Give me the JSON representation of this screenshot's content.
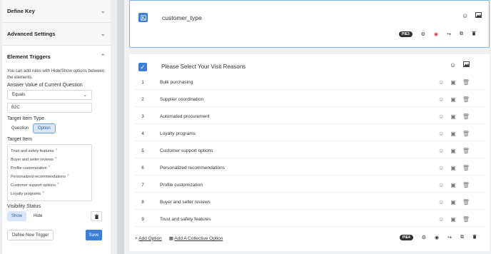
{
  "left_panel": {
    "define_key": "Define Key",
    "advanced_settings": "Advanced Settings",
    "element_triggers": "Element Triggers",
    "description": "You can add rules with Hide/Show options between the elements.",
    "answer_value_label": "Answer Value of Current Question",
    "operator_value": "Equals",
    "answer_input_value": "B2C",
    "target_item_type_label": "Target Item Type",
    "type_question": "Question",
    "type_option": "Option",
    "target_item_label": "Target Item",
    "target_items": [
      "Trust and safety features",
      "Buyer and seller reviews",
      "Profile customization",
      "Personalized recommendations",
      "Customer support options",
      "Loyalty programs"
    ],
    "visibility_status_label": "Visibility Status",
    "show_label": "Show",
    "hide_label": "Hide",
    "define_new_trigger": "Define New Trigger",
    "save_label": "Save"
  },
  "card1": {
    "title": "customer_type",
    "id_badge": "PIE3"
  },
  "card2": {
    "title": "Please Select Your Visit Reasons",
    "id_badge": "PIE4",
    "options": [
      {
        "num": "1",
        "text": "Bulk purchasing"
      },
      {
        "num": "2",
        "text": "Supplier coordination"
      },
      {
        "num": "3",
        "text": "Automated procurement"
      },
      {
        "num": "4",
        "text": "Loyalty programs"
      },
      {
        "num": "5",
        "text": "Customer support options"
      },
      {
        "num": "6",
        "text": "Personalized recommendations"
      },
      {
        "num": "7",
        "text": "Profile customization"
      },
      {
        "num": "8",
        "text": "Buyer and seller reviews"
      },
      {
        "num": "9",
        "text": "Trust and safety features"
      }
    ],
    "add_option": "Add Option",
    "add_collective_option": "Add A Collective Option"
  },
  "colors": {
    "accent": "#3d7fd6",
    "selected_border": "#7fb3e6"
  }
}
